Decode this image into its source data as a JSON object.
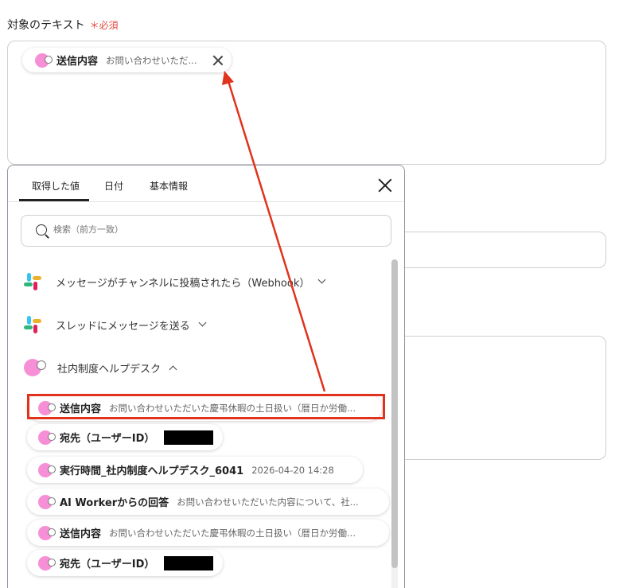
{
  "field": {
    "label": "対象のテキスト",
    "required": "＊必須"
  },
  "selected_chip": {
    "name": "送信内容",
    "value": "お問い合わせいただ..."
  },
  "popup": {
    "tabs": [
      "取得した値",
      "日付",
      "基本情報"
    ],
    "search_placeholder": "検索（前方一致）",
    "groups": [
      {
        "label": "メッセージがチャンネルに投稿されたら（Webhook）",
        "icon": "slack-icon",
        "state": "collapsed"
      },
      {
        "label": "スレッドにメッセージを送る",
        "icon": "slack-icon",
        "state": "collapsed"
      },
      {
        "label": "社内制度ヘルプデスク",
        "icon": "yoom-avatar",
        "state": "expanded"
      }
    ],
    "items": [
      {
        "name": "送信内容",
        "value": "お問い合わせいただいた慶弔休暇の土日扱い（暦日か労働..."
      },
      {
        "name": "宛先（ユーザーID）",
        "value": ""
      },
      {
        "name": "実行時間_社内制度ヘルプデスク_6041",
        "value": "2026-04-20 14:28"
      },
      {
        "name": "AI Workerからの回答",
        "value": "お問い合わせいただいた内容について、社..."
      },
      {
        "name": "送信内容",
        "value": "お問い合わせいただいた慶弔休暇の土日扱い（暦日か労働..."
      },
      {
        "name": "宛先（ユーザーID）",
        "value": ""
      }
    ]
  },
  "colors": {
    "accent_red": "#e0331d",
    "avatar_pink": "#f68fd6"
  }
}
